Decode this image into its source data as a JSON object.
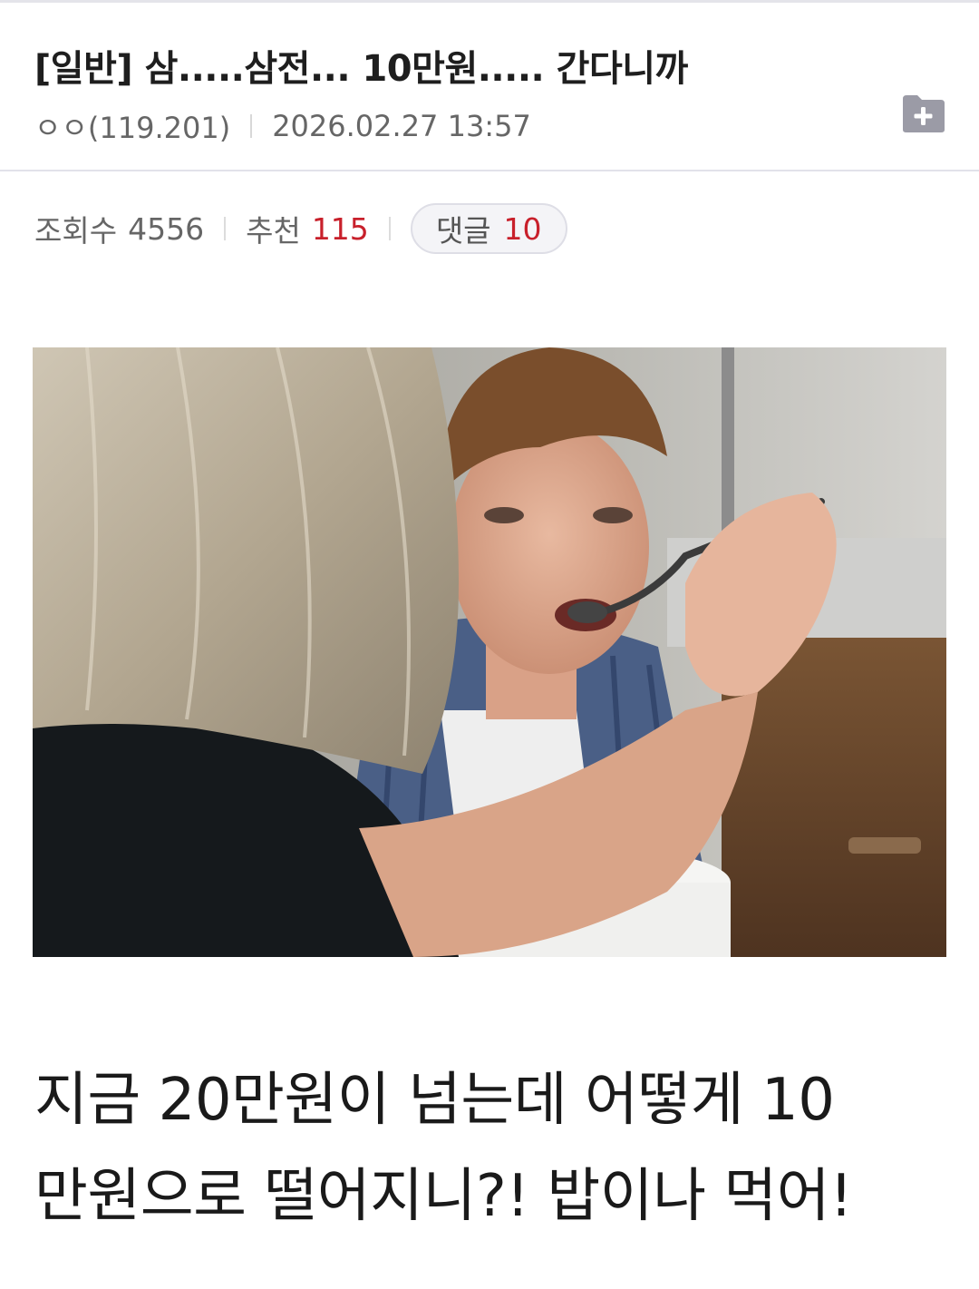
{
  "post": {
    "title": "[일반] 삼.....삼전... 10만원..... 간다니까",
    "author": "ㅇㅇ(119.201)",
    "date": "2026.02.27 13:57",
    "folder_icon": "folder-plus-icon"
  },
  "stats": {
    "views_label": "조회수",
    "views_value": "4556",
    "recommend_label": "추천",
    "recommend_value": "115",
    "comments_label": "댓글",
    "comments_value": "10"
  },
  "content": {
    "image_alt": "photo-woman-spoon-feeding-young-man",
    "text_line1": "지금 20만원이 넘는데 어떻게 10",
    "text_line2": "만원으로 떨어지니?! 밥이나 먹어!"
  },
  "colors": {
    "accent_red": "#c8202b",
    "meta_gray": "#666666",
    "folder_icon_bg": "#9b9ba6"
  }
}
